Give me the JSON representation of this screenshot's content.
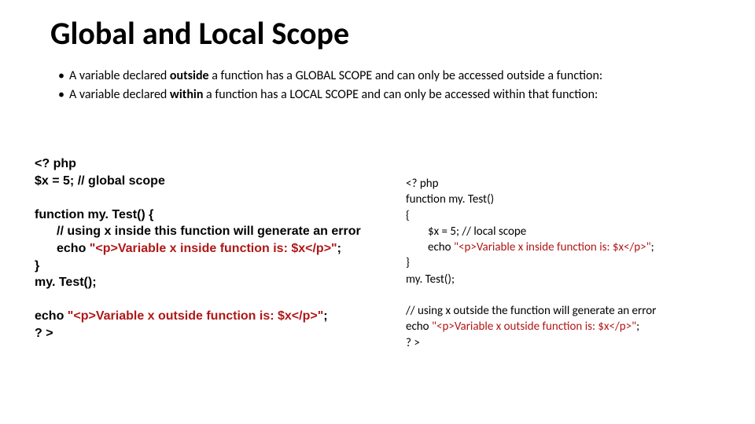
{
  "title": "Global and Local Scope",
  "bullets": [
    {
      "pre": "A variable declared ",
      "strong": "outside",
      "post": " a function has a GLOBAL SCOPE and can only be accessed outside a function:"
    },
    {
      "pre": "A variable declared ",
      "strong": "within",
      "post": " a function has a LOCAL SCOPE and can only be accessed within that function:"
    }
  ],
  "left": {
    "l1": "<? php",
    "l2": "$x = 5; // global scope",
    "l3": "function my. Test() {",
    "l4": "// using x inside this function will generate an error",
    "l5a": "echo ",
    "l5b": "\"<p>Variable x inside function is: $x</p>\"",
    "l5c": ";",
    "l6": "}",
    "l7": "my. Test();",
    "l8a": "echo ",
    "l8b": "\"<p>Variable x outside function is: $x</p>\"",
    "l8c": ";",
    "l9": "? >"
  },
  "right": {
    "r1": "<? php",
    "r2": "function my. Test()",
    "r3": "{",
    "r4": "$x = 5; // local scope",
    "r5a": "echo ",
    "r5b": "\"<p>Variable x inside function is: $x</p>\"",
    "r5c": ";",
    "r6": "}",
    "r7": "my. Test();",
    "r8": "// using x outside the function will generate an error",
    "r9a": "echo ",
    "r9b": "\"<p>Variable x outside function is: $x</p>\"",
    "r9c": ";",
    "r10": "? >"
  }
}
